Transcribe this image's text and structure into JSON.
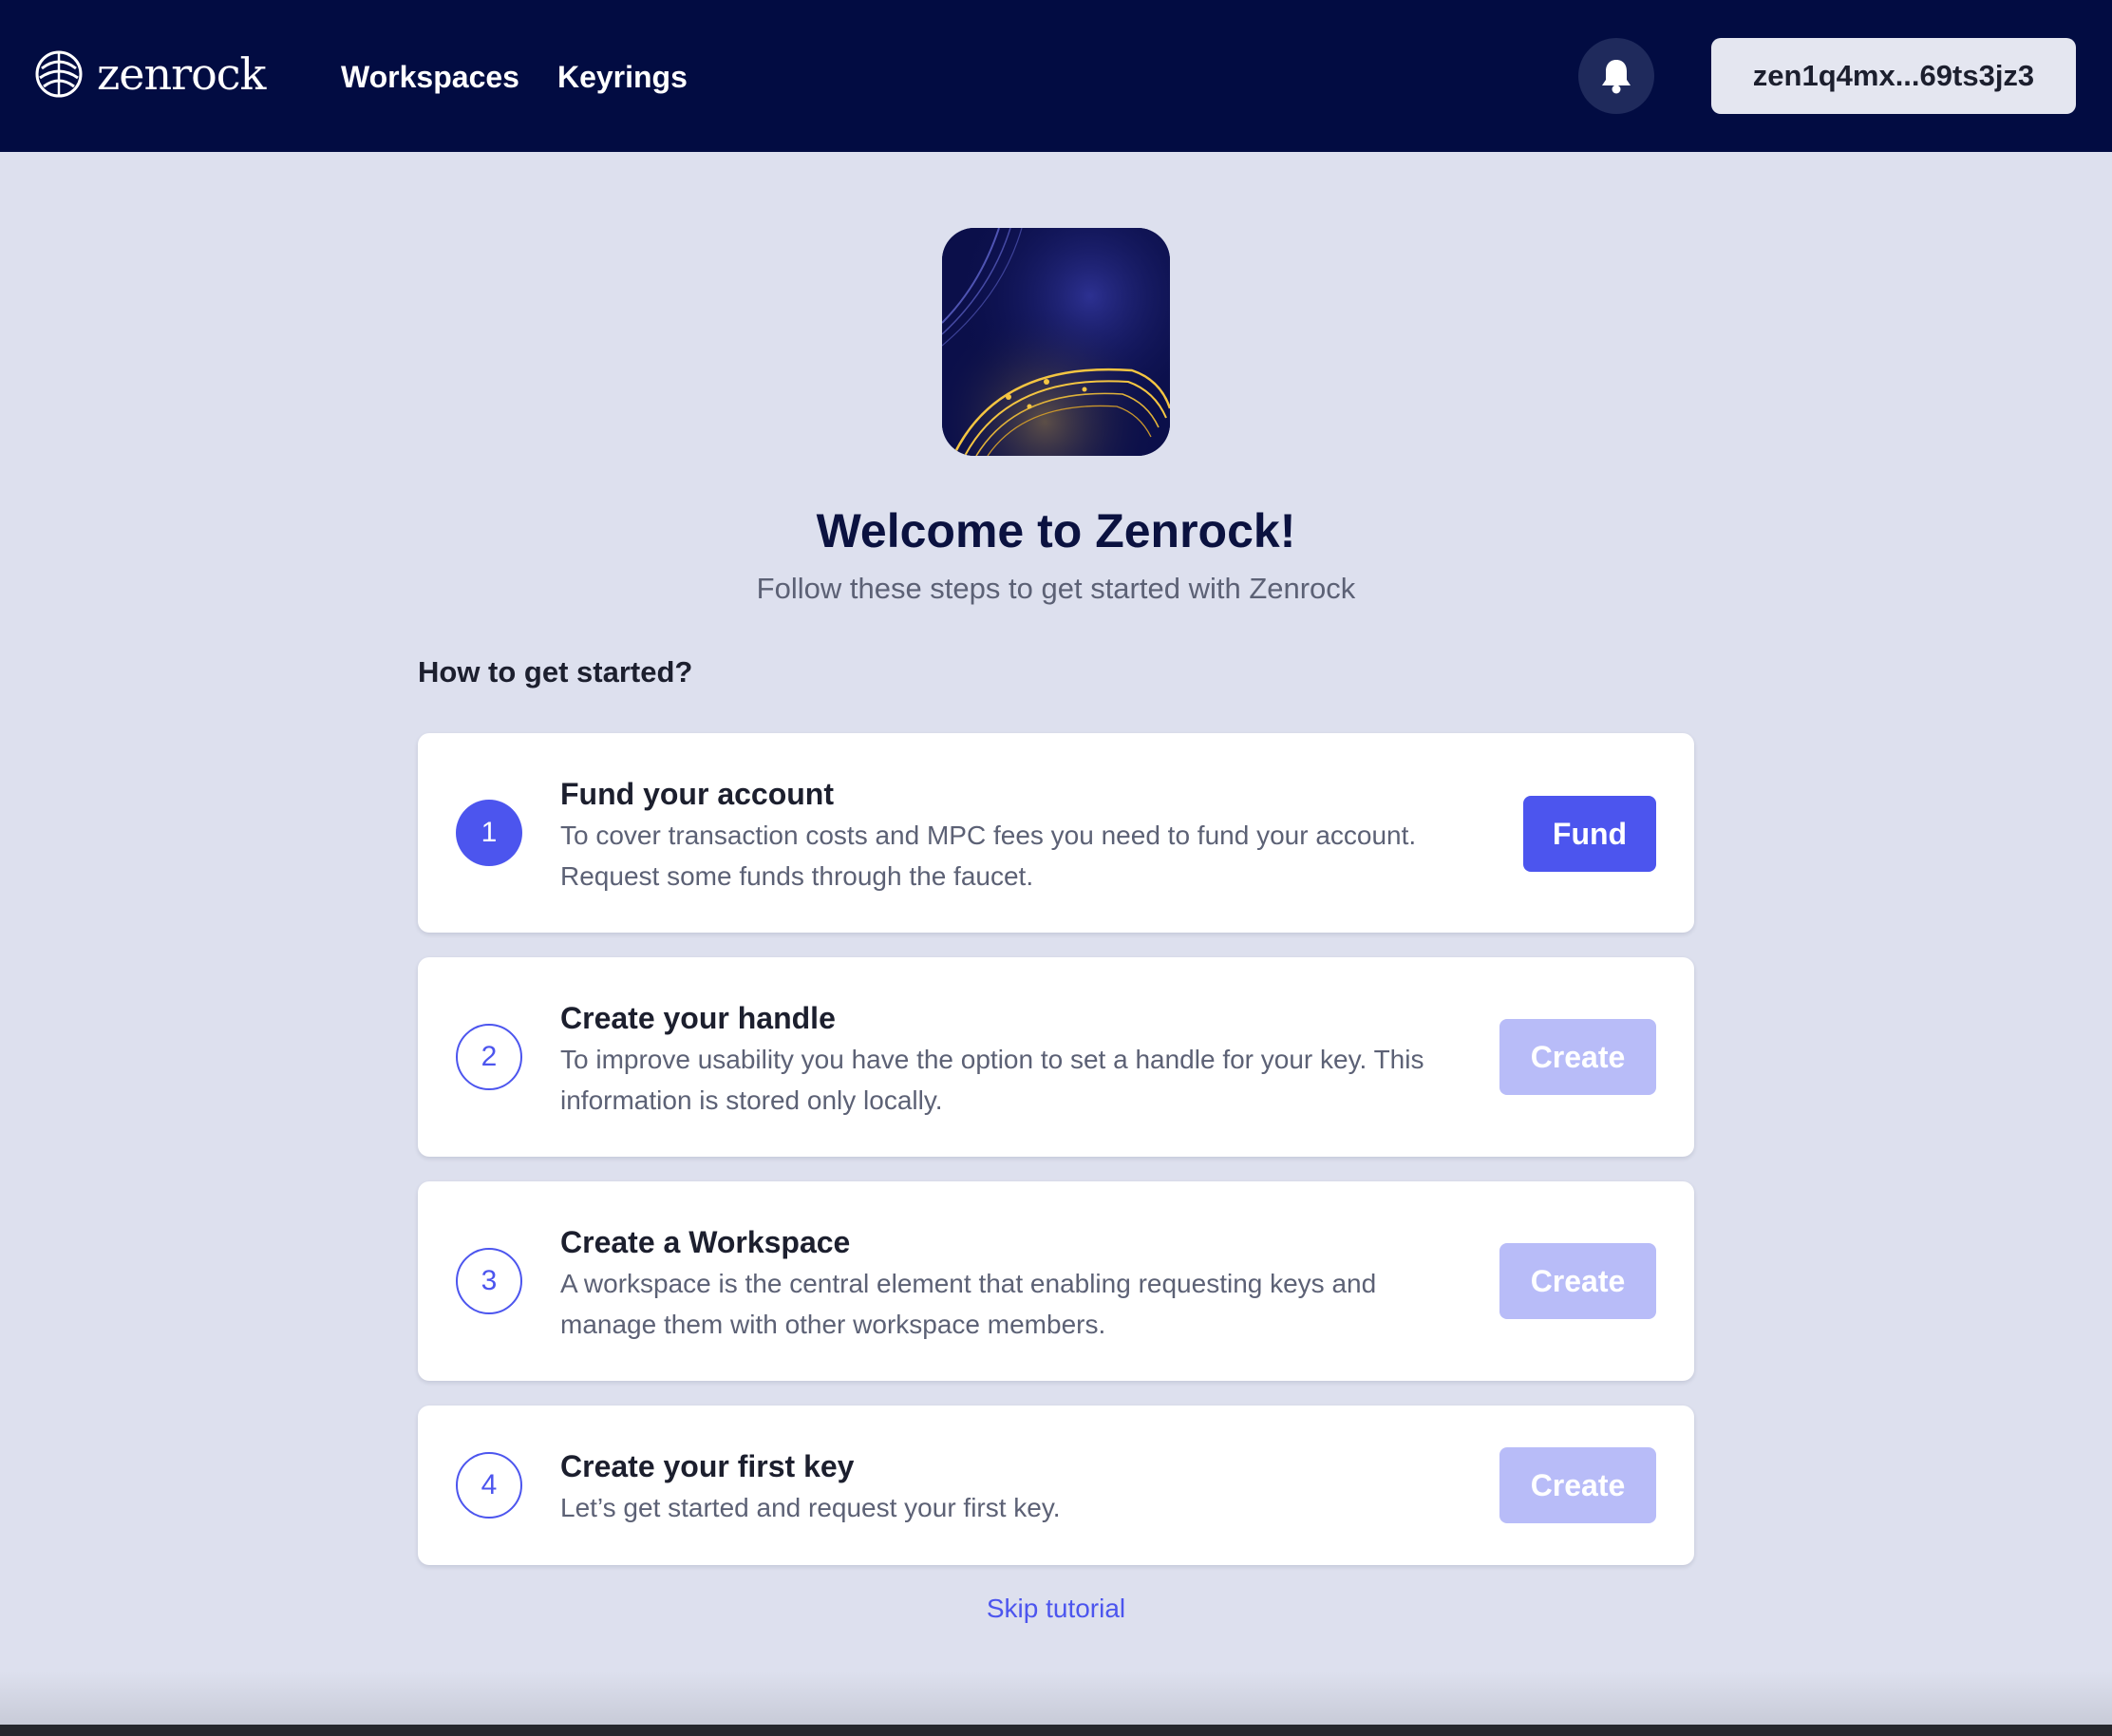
{
  "header": {
    "logo_text": "zenrock",
    "logo_icon": "zenrock-logo-mark",
    "nav": [
      {
        "label": "Workspaces"
      },
      {
        "label": "Keyrings"
      }
    ],
    "notifications_icon": "bell-icon",
    "account_address": "zen1q4mx...69ts3jz3"
  },
  "hero": {
    "title": "Welcome to Zenrock!",
    "subtitle": "Follow these steps to get started with Zenrock"
  },
  "onboarding": {
    "heading": "How to get started?",
    "steps": [
      {
        "number": "1",
        "title": "Fund your account",
        "description": "To cover transaction costs and MPC fees you need to fund your account. Request some funds through the faucet.",
        "action_label": "Fund",
        "action_enabled": true
      },
      {
        "number": "2",
        "title": "Create your handle",
        "description": "To improve usability you have the option to set a handle for your key. This information is stored only locally.",
        "action_label": "Create",
        "action_enabled": false
      },
      {
        "number": "3",
        "title": "Create a Workspace",
        "description": "A workspace is the central element that enabling requesting keys and manage them with other workspace members.",
        "action_label": "Create",
        "action_enabled": false
      },
      {
        "number": "4",
        "title": "Create your first key",
        "description": "Let’s get started and request your first key.",
        "action_label": "Create",
        "action_enabled": false
      }
    ],
    "skip_label": "Skip tutorial"
  },
  "colors": {
    "navbar": "#020c42",
    "background": "#dde0ee",
    "accent": "#4c55ee",
    "accent_disabled": "#b8bcf8",
    "title": "#0b1240"
  }
}
